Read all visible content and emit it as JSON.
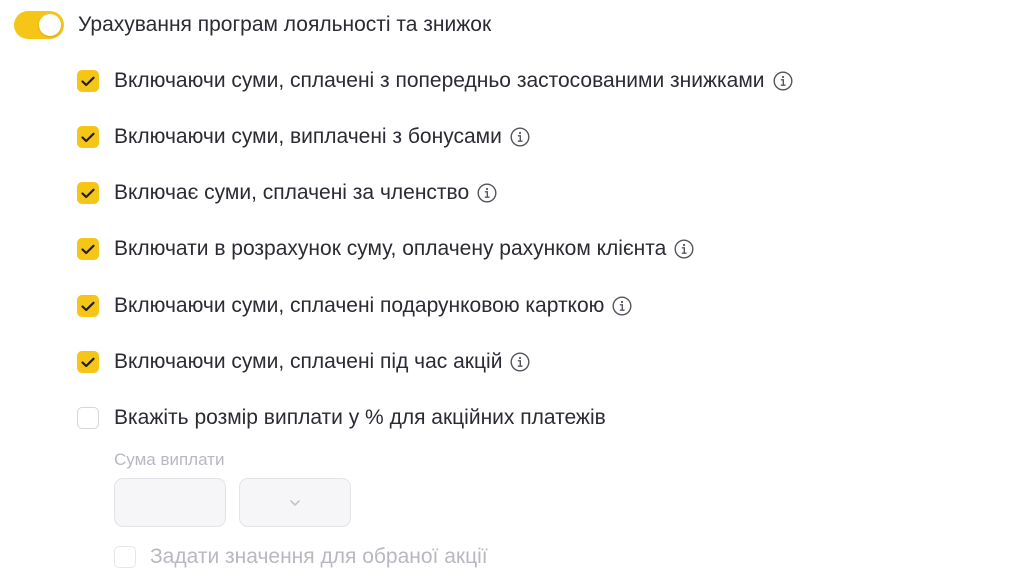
{
  "loyalty_toggle": {
    "label": "Урахування програм лояльності та знижок",
    "enabled": true
  },
  "options": [
    {
      "label": "Включаючи суми, сплачені з попередньо застосованими знижками",
      "checked": true,
      "info_icon": "info-circle-icon"
    },
    {
      "label": "Включаючи суми, виплачені з бонусами",
      "checked": true,
      "info_icon": "info-circle-icon"
    },
    {
      "label": "Включає суми, сплачені за членство",
      "checked": true,
      "info_icon": "info-circle-icon"
    },
    {
      "label": "Включати в розрахунок суму, оплачену рахунком клієнта",
      "checked": true,
      "info_icon": "info-circle-icon"
    },
    {
      "label": "Включаючи суми, сплачені подарунковою карткою",
      "checked": true,
      "info_icon": "info-circle-icon"
    },
    {
      "label": "Включаючи суми, сплачені під час акцій",
      "checked": true,
      "info_icon": "info-circle-icon"
    },
    {
      "label": "Вкажіть розмір виплати у % для акційних платежів",
      "checked": false
    }
  ],
  "payout": {
    "label": "Сума виплати",
    "amount_value": "",
    "unit_value": "",
    "unit_icon": "chevron-down-icon",
    "promo_checkbox_label": "Задати значення для обраної акції",
    "promo_checked": false
  },
  "colors": {
    "accent": "#f5c518",
    "text": "#2b2b33",
    "disabled_text": "#b8b8c0"
  }
}
